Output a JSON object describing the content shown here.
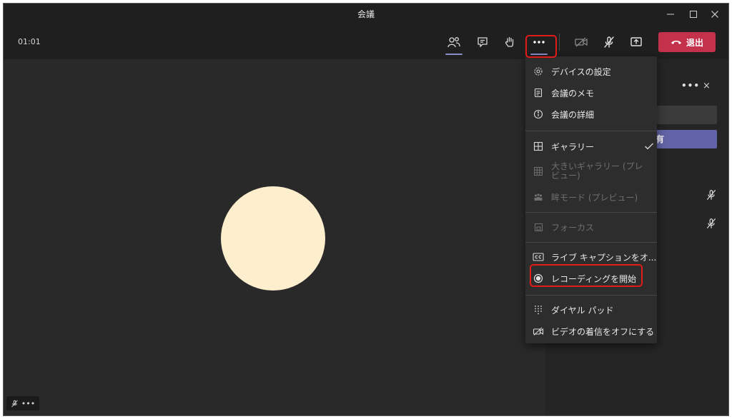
{
  "window": {
    "title": "会議",
    "minimize_icon": "minimize-icon",
    "maximize_icon": "maximize-icon",
    "close_icon": "close-icon"
  },
  "toolbar": {
    "timer": "01:01",
    "icons": [
      "participants-icon",
      "chat-icon",
      "raise-hand-icon",
      "more-actions-icon",
      "camera-off-icon",
      "mic-off-icon",
      "share-screen-icon"
    ],
    "leave_label": "退出",
    "leave_color": "#c4314b"
  },
  "menu": {
    "device_settings": "デバイスの設定",
    "meeting_notes": "会議のメモ",
    "meeting_details": "会議の詳細",
    "gallery": "ギャラリー",
    "large_gallery": "大きいギャラリー (プレビュー)",
    "together_mode": "眸モード (プレビュー)",
    "focus": "フォーカス",
    "live_captions": "ライブ キャプションをオ...",
    "start_recording": "レコーディングを開始",
    "dial_pad": "ダイヤル パッド",
    "incoming_video_off": "ビデオの着信をオフにする"
  },
  "side_panel": {
    "share_label": "有",
    "more": "•••",
    "close": "×"
  },
  "self_preview": {
    "more": "•••"
  },
  "colors": {
    "accent": "#6264a7",
    "highlight": "#e11a1a",
    "avatar": "#fdeecd"
  }
}
